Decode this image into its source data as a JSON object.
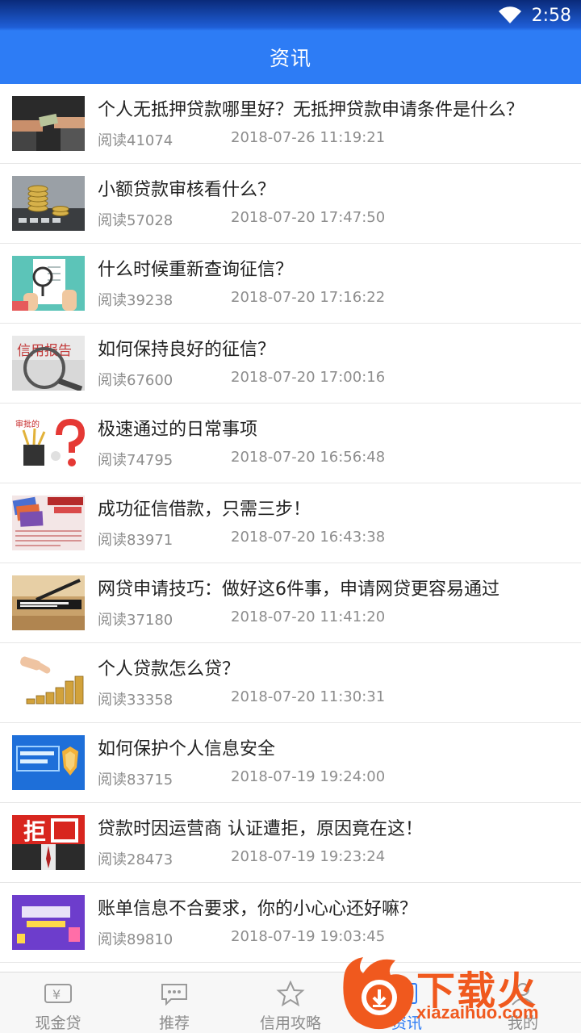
{
  "status_bar": {
    "time": "2:58"
  },
  "header": {
    "title": "资讯"
  },
  "news": [
    {
      "title": "个人无抵押贷款哪里好？无抵押贷款申请条件是什么？",
      "reads": "阅读41074",
      "date": "2018-07-26 11:19:21"
    },
    {
      "title": "小额贷款审核看什么？",
      "reads": "阅读57028",
      "date": "2018-07-20 17:47:50"
    },
    {
      "title": "什么时候重新查询征信？",
      "reads": "阅读39238",
      "date": "2018-07-20 17:16:22"
    },
    {
      "title": "如何保持良好的征信？",
      "reads": "阅读67600",
      "date": "2018-07-20 17:00:16"
    },
    {
      "title": "极速通过的日常事项",
      "reads": "阅读74795",
      "date": "2018-07-20 16:56:48"
    },
    {
      "title": "成功征信借款，只需三步！",
      "reads": "阅读83971",
      "date": "2018-07-20 16:43:38"
    },
    {
      "title": "网贷申请技巧：做好这6件事，申请网贷更容易通过",
      "reads": "阅读37180",
      "date": "2018-07-20 11:41:20"
    },
    {
      "title": "个人贷款怎么贷？",
      "reads": "阅读33358",
      "date": "2018-07-20 11:30:31"
    },
    {
      "title": "如何保护个人信息安全",
      "reads": "阅读83715",
      "date": "2018-07-19 19:24:00"
    },
    {
      "title": "贷款时因运营商 认证遭拒，原因竟在这！",
      "reads": "阅读28473",
      "date": "2018-07-19 19:23:24"
    },
    {
      "title": "账单信息不合要求，你的小心心还好嘛？",
      "reads": "阅读89810",
      "date": "2018-07-19 19:03:45"
    }
  ],
  "thumbnails": {
    "t4_text": "信用报告",
    "t5_text": "审批的",
    "t10_text": "拒"
  },
  "tabs": [
    {
      "label": "现金贷",
      "icon": "cash-icon"
    },
    {
      "label": "推荐",
      "icon": "chat-icon"
    },
    {
      "label": "信用攻略",
      "icon": "star-icon"
    },
    {
      "label": "资讯",
      "icon": "news-icon"
    },
    {
      "label": "我的",
      "icon": "user-icon"
    }
  ],
  "watermark": {
    "text": "下载火",
    "url": "xiazaihuo.com"
  },
  "colors": {
    "accent": "#2d7cf5",
    "watermark": "#f0591e"
  }
}
